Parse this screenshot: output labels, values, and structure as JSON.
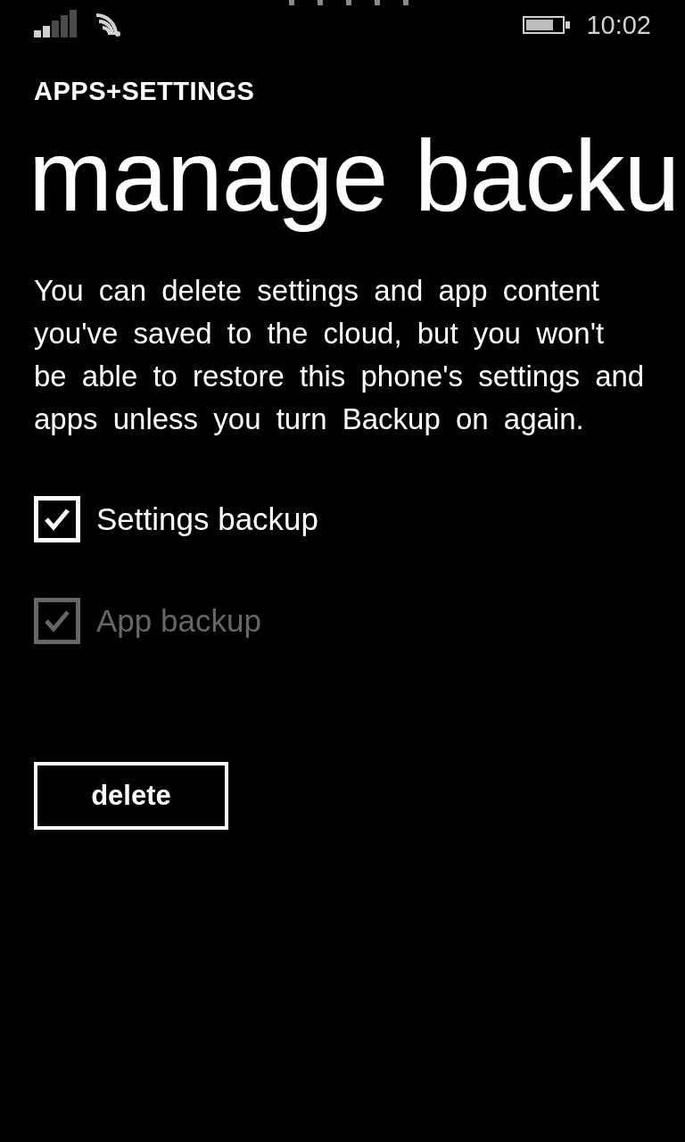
{
  "status_bar": {
    "time": "10:02"
  },
  "header": {
    "section": "APPS+SETTINGS",
    "title": "manage backu"
  },
  "description": "You can delete settings and app content you've saved to the cloud, but you won't be able to restore this phone's settings and apps unless you turn Backup on again.",
  "options": [
    {
      "label": "Settings backup",
      "checked": true,
      "disabled": false
    },
    {
      "label": "App backup",
      "checked": true,
      "disabled": true
    }
  ],
  "buttons": [
    {
      "label": "delete"
    }
  ]
}
